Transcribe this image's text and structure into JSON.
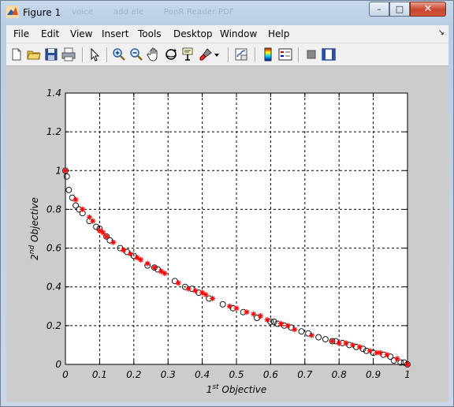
{
  "window": {
    "title": "Figure 1",
    "ghost_tabs": [
      "voice",
      "add ele",
      "PonR Reader PDF"
    ],
    "buttons": {
      "minimize": "–",
      "maximize": "□",
      "close": "✕"
    }
  },
  "menubar": {
    "items": [
      "File",
      "Edit",
      "View",
      "Insert",
      "Tools",
      "Desktop",
      "Window",
      "Help"
    ],
    "dock_arrow": "↘"
  },
  "toolbar": {
    "icons": [
      "new-figure-icon",
      "open-file-icon",
      "save-icon",
      "print-icon",
      "edit-plot-arrow-icon",
      "zoom-in-icon",
      "zoom-out-icon",
      "pan-hand-icon",
      "rotate-3d-icon",
      "data-cursor-icon",
      "brush-icon",
      "brush-dropdown-icon",
      "link-plot-icon",
      "colorbar-icon",
      "legend-icon",
      "hide-plot-tools-icon",
      "show-plot-tools-icon"
    ]
  },
  "chart_data": {
    "type": "scatter",
    "xlabel": "1st Objective",
    "ylabel": "2nd Objective",
    "xlabel_parts": {
      "pre": "1",
      "sup": "st",
      "post": " Objective"
    },
    "ylabel_parts": {
      "pre": "2",
      "sup": "nd",
      "post": " Objective"
    },
    "xlim": [
      0,
      1
    ],
    "ylim": [
      0,
      1.4
    ],
    "xticks": [
      "0",
      "0.1",
      "0.2",
      "0.3",
      "0.4",
      "0.5",
      "0.6",
      "0.7",
      "0.8",
      "0.9",
      "1"
    ],
    "yticks": [
      "0",
      "0.2",
      "0.4",
      "0.6",
      "0.8",
      "1",
      "1.2",
      "1.4"
    ],
    "grid": true,
    "series": [
      {
        "marker": "o",
        "color": "#000000",
        "x": [
          0.0,
          0.004,
          0.01,
          0.02,
          0.03,
          0.04,
          0.05,
          0.07,
          0.09,
          0.1,
          0.12,
          0.13,
          0.16,
          0.18,
          0.2,
          0.24,
          0.26,
          0.27,
          0.32,
          0.35,
          0.37,
          0.39,
          0.42,
          0.46,
          0.49,
          0.52,
          0.56,
          0.6,
          0.61,
          0.62,
          0.64,
          0.66,
          0.69,
          0.71,
          0.74,
          0.76,
          0.78,
          0.79,
          0.81,
          0.83,
          0.85,
          0.87,
          0.88,
          0.9,
          0.93,
          0.95,
          0.96,
          0.98,
          0.99,
          1.0
        ],
        "y": [
          1.0,
          0.97,
          0.9,
          0.86,
          0.82,
          0.8,
          0.78,
          0.74,
          0.71,
          0.7,
          0.66,
          0.64,
          0.6,
          0.58,
          0.56,
          0.51,
          0.5,
          0.49,
          0.43,
          0.4,
          0.39,
          0.37,
          0.34,
          0.31,
          0.29,
          0.27,
          0.24,
          0.22,
          0.22,
          0.21,
          0.2,
          0.19,
          0.17,
          0.16,
          0.14,
          0.13,
          0.12,
          0.12,
          0.11,
          0.1,
          0.09,
          0.08,
          0.07,
          0.06,
          0.05,
          0.04,
          0.02,
          0.01,
          0.01,
          0.0
        ]
      },
      {
        "marker": "*",
        "color": "#ff0000",
        "x": [
          0.0,
          0.03,
          0.05,
          0.07,
          0.08,
          0.1,
          0.11,
          0.12,
          0.14,
          0.17,
          0.19,
          0.21,
          0.22,
          0.24,
          0.26,
          0.28,
          0.29,
          0.33,
          0.36,
          0.38,
          0.4,
          0.41,
          0.43,
          0.48,
          0.5,
          0.53,
          0.55,
          0.57,
          0.59,
          0.63,
          0.65,
          0.67,
          0.72,
          0.78,
          0.8,
          0.82,
          0.84,
          0.86,
          0.89,
          0.91,
          0.92,
          0.94,
          0.97,
          1.0
        ],
        "y": [
          1.0,
          0.85,
          0.8,
          0.76,
          0.74,
          0.69,
          0.68,
          0.66,
          0.63,
          0.59,
          0.57,
          0.55,
          0.54,
          0.52,
          0.5,
          0.48,
          0.47,
          0.42,
          0.39,
          0.38,
          0.37,
          0.36,
          0.34,
          0.3,
          0.29,
          0.27,
          0.26,
          0.25,
          0.23,
          0.21,
          0.2,
          0.18,
          0.15,
          0.12,
          0.11,
          0.11,
          0.1,
          0.09,
          0.07,
          0.06,
          0.06,
          0.05,
          0.03,
          0.0
        ]
      }
    ]
  }
}
